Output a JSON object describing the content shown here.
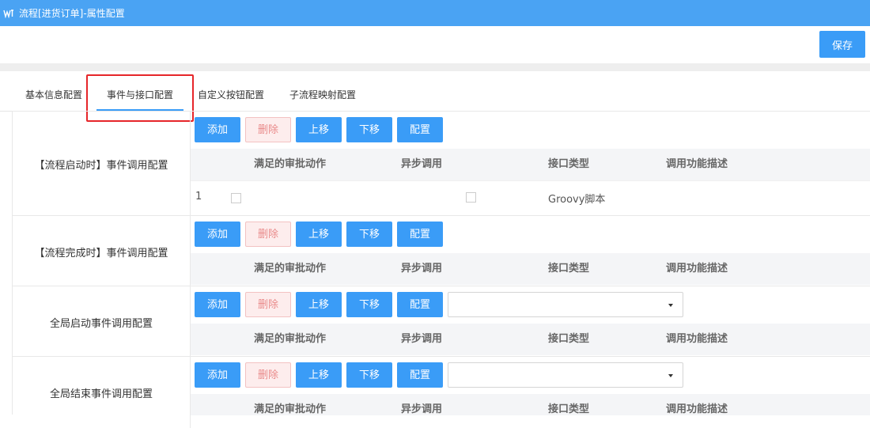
{
  "window": {
    "title": "流程[进货订单]-属性配置"
  },
  "toolbar": {
    "save_label": "保存"
  },
  "tabs": [
    {
      "label": "基本信息配置",
      "active": false
    },
    {
      "label": "事件与接口配置",
      "active": true
    },
    {
      "label": "自定义按钮配置",
      "active": false
    },
    {
      "label": "子流程映射配置",
      "active": false
    }
  ],
  "buttons": {
    "add": "添加",
    "delete": "删除",
    "up": "上移",
    "down": "下移",
    "config": "配置"
  },
  "columns": [
    "满足的审批动作",
    "异步调用",
    "接口类型",
    "调用功能描述"
  ],
  "sections": [
    {
      "label": "【流程启动时】事件调用配置",
      "has_select": false,
      "rows": [
        {
          "index": "1",
          "action_checked": false,
          "async_checked": false,
          "interface_type": "Groovy脚本",
          "description": ""
        }
      ]
    },
    {
      "label": "【流程完成时】事件调用配置",
      "has_select": false,
      "rows": []
    },
    {
      "label": "全局启动事件调用配置",
      "has_select": true,
      "select_value": "",
      "rows": []
    },
    {
      "label": "全局结束事件调用配置",
      "has_select": true,
      "select_value": "",
      "rows": []
    }
  ],
  "colors": {
    "titlebar": "#4aa3f3",
    "primary": "#3a9cf7",
    "danger_bg": "#fdeded",
    "danger_text": "#e98a8a",
    "highlight": "#e6262a"
  }
}
